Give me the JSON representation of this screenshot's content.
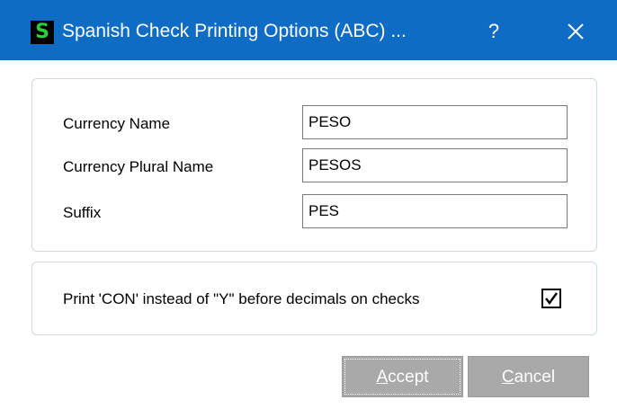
{
  "window": {
    "title": "Spanish Check Printing Options (ABC) ...",
    "app_icon_letter": "S",
    "help_label": "?",
    "close_icon": "close-icon",
    "colors": {
      "titlebar": "#0e6cc4",
      "icon_bg": "#000000",
      "icon_fg": "#2bd03b"
    }
  },
  "form": {
    "currency_name": {
      "label": "Currency Name",
      "value": "PESO"
    },
    "currency_plural": {
      "label": "Currency Plural Name",
      "value": "PESOS"
    },
    "suffix": {
      "label": "Suffix",
      "value": "PES"
    }
  },
  "options": {
    "con_label": "Print 'CON' instead of \"Y\" before decimals on checks",
    "con_checked": true
  },
  "buttons": {
    "accept": {
      "mnemonic": "A",
      "rest": "ccept"
    },
    "cancel": {
      "mnemonic": "C",
      "rest": "ancel"
    }
  }
}
